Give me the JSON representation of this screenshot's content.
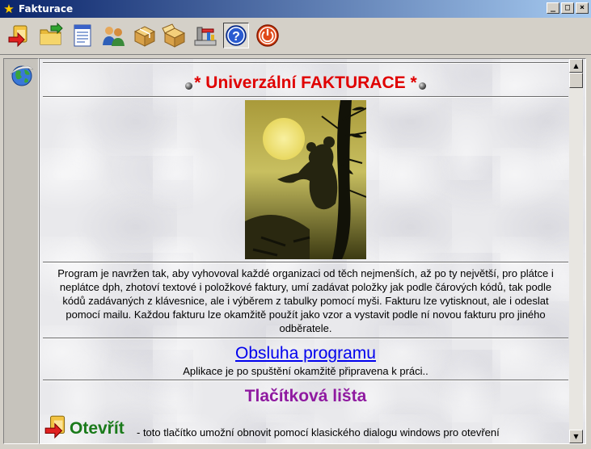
{
  "window": {
    "title": "Fakturace",
    "controls": {
      "minimize": "_",
      "maximize": "□",
      "close": "×"
    }
  },
  "toolbar": {
    "buttons": [
      {
        "name": "exit-door",
        "icon": "red-arrow-door-icon"
      },
      {
        "name": "open-folder",
        "icon": "folder-arrow-icon"
      },
      {
        "name": "document-list",
        "icon": "document-list-icon"
      },
      {
        "name": "customers",
        "icon": "people-icon"
      },
      {
        "name": "box",
        "icon": "package-icon"
      },
      {
        "name": "box-open",
        "icon": "package-open-icon"
      },
      {
        "name": "tools",
        "icon": "tools-icon"
      },
      {
        "name": "help",
        "icon": "question-icon"
      },
      {
        "name": "power",
        "icon": "power-icon"
      }
    ]
  },
  "page": {
    "heading": "* Univerzální FAKTURACE *",
    "description": "Program je navržen tak, aby vyhovoval každé organizaci od těch nejmenších, až po ty největší, pro plátce i neplátce dph, zhotoví textové i položkové faktury, umí zadávat položky jak podle čárových kódů, tak podle kódů zadávaných z klávesnice, ale i výběrem z tabulky pomocí myši. Fakturu lze vytisknout, ale i odeslat pomocí mailu. Každou fakturu lze okamžitě použít jako vzor a vystavit podle ní novou fakturu pro jiného odběratele.",
    "operation_link": "Obsluha programu ",
    "operation_sub": "Aplikace je po spuštění okamžitě připravena k práci..",
    "toolbar_section_title": "Tlačítková lišta",
    "feature_open_name": "Otevřít",
    "feature_open_text": " - toto tlačítko umožní obnovit pomocí klasického dialogu windows pro otevření"
  },
  "scrollbar": {
    "up": "▲",
    "down": "▼"
  },
  "colors": {
    "heading_red": "#e00000",
    "link_blue": "#0000ee",
    "section_purple": "#8f1aa0",
    "feature_green": "#1a7a1a",
    "titlebar_start": "#0a246a",
    "titlebar_end": "#a6caf0"
  }
}
